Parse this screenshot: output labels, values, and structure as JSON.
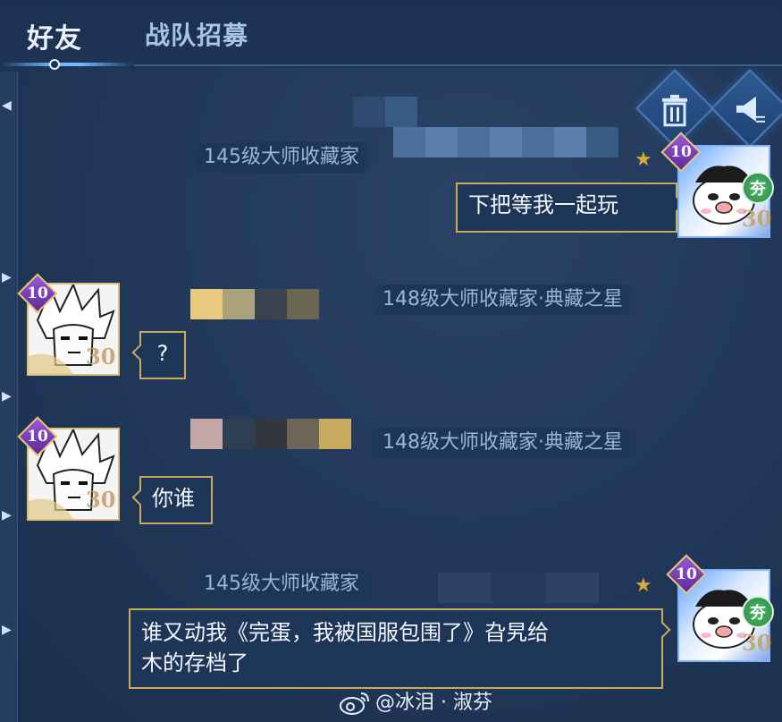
{
  "tabs": [
    {
      "label": "好友",
      "active": true
    },
    {
      "label": "战队招募",
      "active": false
    }
  ],
  "toolbar": {
    "delete_icon": "trash-icon",
    "settings_icon": "broadcast-switch-icon"
  },
  "messages": [
    {
      "side": "right",
      "sender_title": "145级大师收藏家",
      "text": "下把等我一起玩",
      "avatar_level": "10",
      "avatar_badge": "30",
      "avatar_tag": "夯"
    },
    {
      "side": "left",
      "sender_title": "148级大师收藏家·典藏之星",
      "text": "?",
      "avatar_level": "10",
      "avatar_badge": "30"
    },
    {
      "side": "left",
      "sender_title": "148级大师收藏家·典藏之星",
      "text": "你谁",
      "avatar_level": "10",
      "avatar_badge": "30"
    },
    {
      "side": "right",
      "sender_title": "145级大师收藏家",
      "text_line1": "谁又动我《完蛋，我被国服包围了》旮旯给",
      "text_line2": "木的存档了",
      "avatar_level": "10",
      "avatar_badge": "30",
      "avatar_tag": "夯"
    }
  ],
  "watermark": {
    "logo_icon": "weibo-icon",
    "text": "@冰泪 · 淑芬"
  },
  "colors": {
    "bubble_border": "#c9a95a",
    "accent_blue": "#6fb9ff"
  }
}
